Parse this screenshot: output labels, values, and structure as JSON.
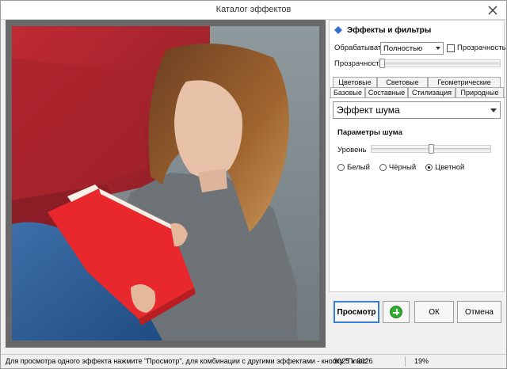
{
  "window": {
    "title": "Каталог эффектов"
  },
  "panel": {
    "section_title": "Эффекты и фильтры",
    "process_label": "Обрабатывать",
    "process_value": "Полностью",
    "transparency_check_label": "Прозрачность",
    "transparency_slider_label": "Прозрачность",
    "tabs_top": [
      "Цветовые",
      "Световые",
      "Геометрические"
    ],
    "tabs_bottom": [
      "Базовые",
      "Составные",
      "Стилизация",
      "Природные"
    ],
    "effect_select_value": "Эффект шума",
    "params_title": "Параметры шума",
    "level_label": "Уровень",
    "level_value": 0.5,
    "radio_options": [
      "Белый",
      "Чёрный",
      "Цветной"
    ],
    "radio_selected": "Цветной"
  },
  "buttons": {
    "preview": "Просмотр",
    "ok": "ОК",
    "cancel": "Отмена"
  },
  "status": {
    "hint": "Для просмотра одного эффекта нажмите \"Просмотр\", для комбинации с другими эффектами - кнопку \"Плюс\"",
    "dimensions": "3025 x 3026",
    "zoom": "19%"
  },
  "colors": {
    "accent": "#3a7bd5",
    "plus_green": "#2fae2f"
  }
}
